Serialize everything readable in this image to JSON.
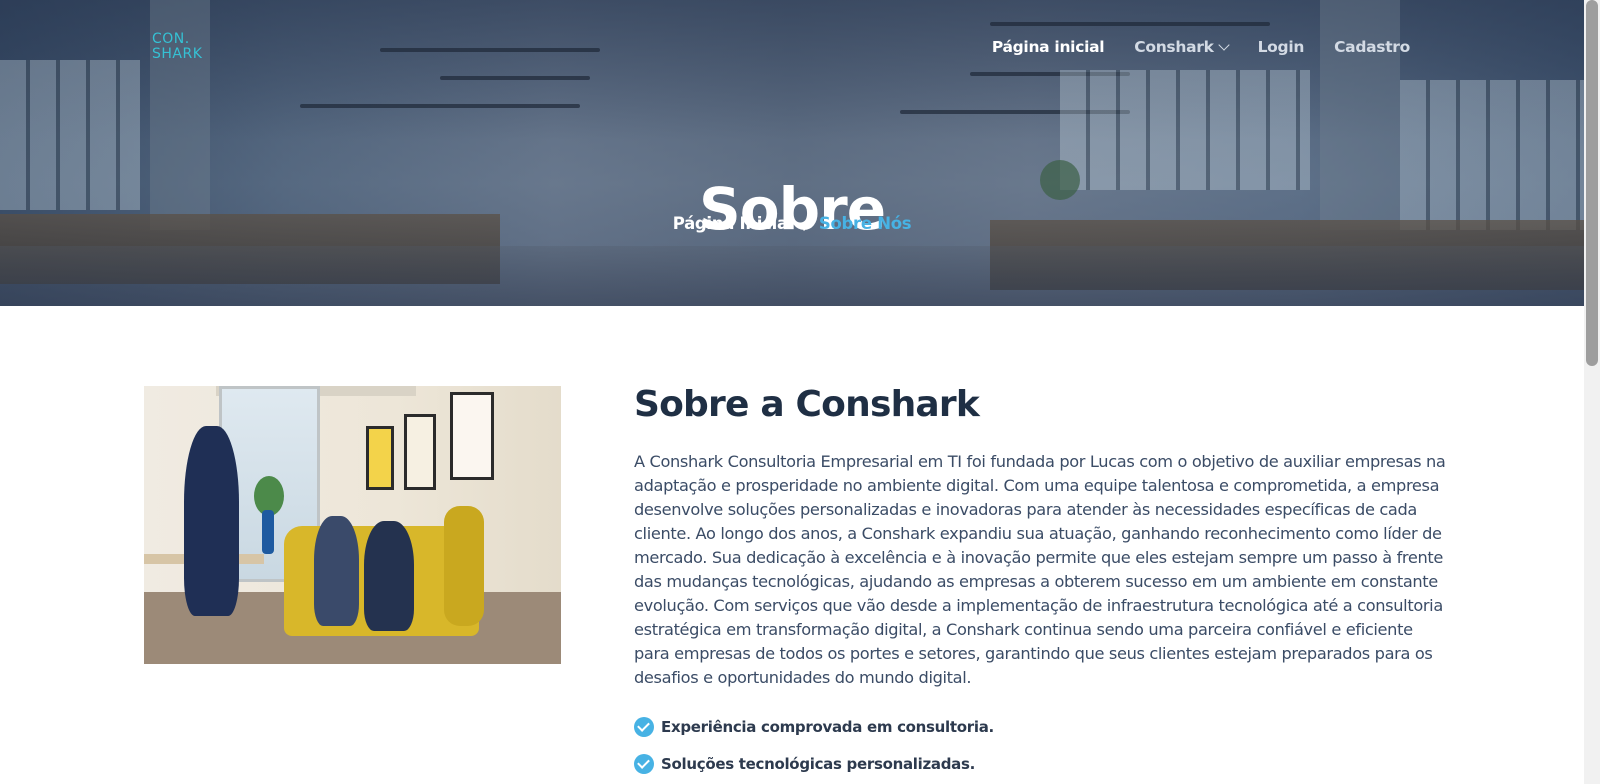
{
  "brand": {
    "logo_line1": "CON.",
    "logo_line2": "SHARK",
    "accent": "#47b2e4",
    "logo_color": "#35c1d4"
  },
  "nav": {
    "items": [
      {
        "label": "Página inicial",
        "active": true
      },
      {
        "label": "Conshark",
        "has_dropdown": true
      },
      {
        "label": "Login"
      },
      {
        "label": "Cadastro"
      }
    ]
  },
  "hero": {
    "title": "Sobre",
    "breadcrumb": {
      "home": "Página Inicial",
      "separator": "/",
      "current": "Sobre Nós"
    }
  },
  "about": {
    "heading": "Sobre a Conshark",
    "paragraph": "A Conshark Consultoria Empresarial em TI foi fundada por Lucas com o objetivo de auxiliar empresas na adaptação e prosperidade no ambiente digital. Com uma equipe talentosa e comprometida, a empresa desenvolve soluções personalizadas e inovadoras para atender às necessidades específicas de cada cliente. Ao longo dos anos, a Conshark expandiu sua atuação, ganhando reconhecimento como líder de mercado. Sua dedicação à excelência e à inovação permite que eles estejam sempre um passo à frente das mudanças tecnológicas, ajudando as empresas a obterem sucesso em um ambiente em constante evolução. Com serviços que vão desde a implementação de infraestrutura tecnológica até a consultoria estratégica em transformação digital, a Conshark continua sendo uma parceira confiável e eficiente para empresas de todos os portes e setores, garantindo que seus clientes estejam preparados para os desafios e oportunidades do mundo digital.",
    "checks": [
      "Experiência comprovada em consultoria.",
      "Soluções tecnológicas personalizadas."
    ]
  },
  "icons": {
    "check": "check-circle-icon",
    "dropdown": "chevron-down-icon"
  }
}
